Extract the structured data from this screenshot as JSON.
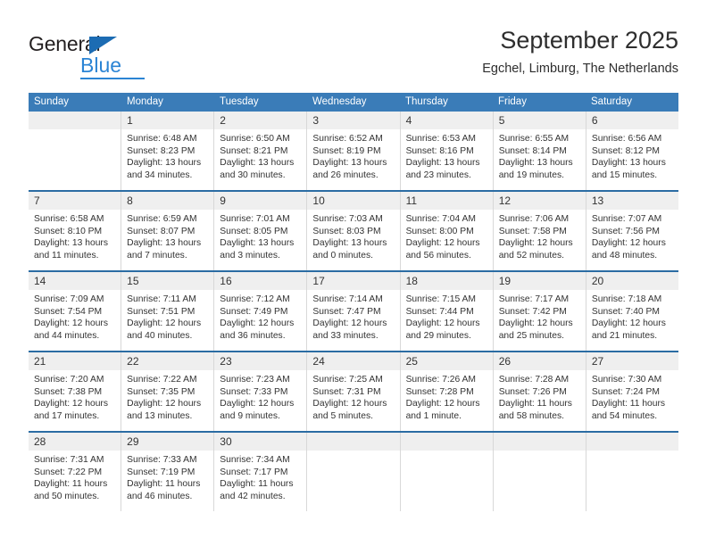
{
  "brand": {
    "name_dark": "General",
    "name_blue": "Blue",
    "triangle_color": "#1c6cb3",
    "blue_color": "#2b84d4"
  },
  "header": {
    "title": "September 2025",
    "subtitle": "Egchel, Limburg, The Netherlands"
  },
  "theme": {
    "header_row_bg": "#3a7cb8",
    "week_separator": "#2b6ca3",
    "daynum_bg": "#efefef",
    "cell_border": "#d8d8d8",
    "text": "#333333"
  },
  "calendar": {
    "weekdays": [
      "Sunday",
      "Monday",
      "Tuesday",
      "Wednesday",
      "Thursday",
      "Friday",
      "Saturday"
    ],
    "weeks": [
      [
        {
          "day": "",
          "empty": true,
          "sunrise": "",
          "sunset": "",
          "daylight1": "",
          "daylight2": ""
        },
        {
          "day": "1",
          "sunrise": "Sunrise: 6:48 AM",
          "sunset": "Sunset: 8:23 PM",
          "daylight1": "Daylight: 13 hours",
          "daylight2": "and 34 minutes."
        },
        {
          "day": "2",
          "sunrise": "Sunrise: 6:50 AM",
          "sunset": "Sunset: 8:21 PM",
          "daylight1": "Daylight: 13 hours",
          "daylight2": "and 30 minutes."
        },
        {
          "day": "3",
          "sunrise": "Sunrise: 6:52 AM",
          "sunset": "Sunset: 8:19 PM",
          "daylight1": "Daylight: 13 hours",
          "daylight2": "and 26 minutes."
        },
        {
          "day": "4",
          "sunrise": "Sunrise: 6:53 AM",
          "sunset": "Sunset: 8:16 PM",
          "daylight1": "Daylight: 13 hours",
          "daylight2": "and 23 minutes."
        },
        {
          "day": "5",
          "sunrise": "Sunrise: 6:55 AM",
          "sunset": "Sunset: 8:14 PM",
          "daylight1": "Daylight: 13 hours",
          "daylight2": "and 19 minutes."
        },
        {
          "day": "6",
          "sunrise": "Sunrise: 6:56 AM",
          "sunset": "Sunset: 8:12 PM",
          "daylight1": "Daylight: 13 hours",
          "daylight2": "and 15 minutes."
        }
      ],
      [
        {
          "day": "7",
          "sunrise": "Sunrise: 6:58 AM",
          "sunset": "Sunset: 8:10 PM",
          "daylight1": "Daylight: 13 hours",
          "daylight2": "and 11 minutes."
        },
        {
          "day": "8",
          "sunrise": "Sunrise: 6:59 AM",
          "sunset": "Sunset: 8:07 PM",
          "daylight1": "Daylight: 13 hours",
          "daylight2": "and 7 minutes."
        },
        {
          "day": "9",
          "sunrise": "Sunrise: 7:01 AM",
          "sunset": "Sunset: 8:05 PM",
          "daylight1": "Daylight: 13 hours",
          "daylight2": "and 3 minutes."
        },
        {
          "day": "10",
          "sunrise": "Sunrise: 7:03 AM",
          "sunset": "Sunset: 8:03 PM",
          "daylight1": "Daylight: 13 hours",
          "daylight2": "and 0 minutes."
        },
        {
          "day": "11",
          "sunrise": "Sunrise: 7:04 AM",
          "sunset": "Sunset: 8:00 PM",
          "daylight1": "Daylight: 12 hours",
          "daylight2": "and 56 minutes."
        },
        {
          "day": "12",
          "sunrise": "Sunrise: 7:06 AM",
          "sunset": "Sunset: 7:58 PM",
          "daylight1": "Daylight: 12 hours",
          "daylight2": "and 52 minutes."
        },
        {
          "day": "13",
          "sunrise": "Sunrise: 7:07 AM",
          "sunset": "Sunset: 7:56 PM",
          "daylight1": "Daylight: 12 hours",
          "daylight2": "and 48 minutes."
        }
      ],
      [
        {
          "day": "14",
          "sunrise": "Sunrise: 7:09 AM",
          "sunset": "Sunset: 7:54 PM",
          "daylight1": "Daylight: 12 hours",
          "daylight2": "and 44 minutes."
        },
        {
          "day": "15",
          "sunrise": "Sunrise: 7:11 AM",
          "sunset": "Sunset: 7:51 PM",
          "daylight1": "Daylight: 12 hours",
          "daylight2": "and 40 minutes."
        },
        {
          "day": "16",
          "sunrise": "Sunrise: 7:12 AM",
          "sunset": "Sunset: 7:49 PM",
          "daylight1": "Daylight: 12 hours",
          "daylight2": "and 36 minutes."
        },
        {
          "day": "17",
          "sunrise": "Sunrise: 7:14 AM",
          "sunset": "Sunset: 7:47 PM",
          "daylight1": "Daylight: 12 hours",
          "daylight2": "and 33 minutes."
        },
        {
          "day": "18",
          "sunrise": "Sunrise: 7:15 AM",
          "sunset": "Sunset: 7:44 PM",
          "daylight1": "Daylight: 12 hours",
          "daylight2": "and 29 minutes."
        },
        {
          "day": "19",
          "sunrise": "Sunrise: 7:17 AM",
          "sunset": "Sunset: 7:42 PM",
          "daylight1": "Daylight: 12 hours",
          "daylight2": "and 25 minutes."
        },
        {
          "day": "20",
          "sunrise": "Sunrise: 7:18 AM",
          "sunset": "Sunset: 7:40 PM",
          "daylight1": "Daylight: 12 hours",
          "daylight2": "and 21 minutes."
        }
      ],
      [
        {
          "day": "21",
          "sunrise": "Sunrise: 7:20 AM",
          "sunset": "Sunset: 7:38 PM",
          "daylight1": "Daylight: 12 hours",
          "daylight2": "and 17 minutes."
        },
        {
          "day": "22",
          "sunrise": "Sunrise: 7:22 AM",
          "sunset": "Sunset: 7:35 PM",
          "daylight1": "Daylight: 12 hours",
          "daylight2": "and 13 minutes."
        },
        {
          "day": "23",
          "sunrise": "Sunrise: 7:23 AM",
          "sunset": "Sunset: 7:33 PM",
          "daylight1": "Daylight: 12 hours",
          "daylight2": "and 9 minutes."
        },
        {
          "day": "24",
          "sunrise": "Sunrise: 7:25 AM",
          "sunset": "Sunset: 7:31 PM",
          "daylight1": "Daylight: 12 hours",
          "daylight2": "and 5 minutes."
        },
        {
          "day": "25",
          "sunrise": "Sunrise: 7:26 AM",
          "sunset": "Sunset: 7:28 PM",
          "daylight1": "Daylight: 12 hours",
          "daylight2": "and 1 minute."
        },
        {
          "day": "26",
          "sunrise": "Sunrise: 7:28 AM",
          "sunset": "Sunset: 7:26 PM",
          "daylight1": "Daylight: 11 hours",
          "daylight2": "and 58 minutes."
        },
        {
          "day": "27",
          "sunrise": "Sunrise: 7:30 AM",
          "sunset": "Sunset: 7:24 PM",
          "daylight1": "Daylight: 11 hours",
          "daylight2": "and 54 minutes."
        }
      ],
      [
        {
          "day": "28",
          "sunrise": "Sunrise: 7:31 AM",
          "sunset": "Sunset: 7:22 PM",
          "daylight1": "Daylight: 11 hours",
          "daylight2": "and 50 minutes."
        },
        {
          "day": "29",
          "sunrise": "Sunrise: 7:33 AM",
          "sunset": "Sunset: 7:19 PM",
          "daylight1": "Daylight: 11 hours",
          "daylight2": "and 46 minutes."
        },
        {
          "day": "30",
          "sunrise": "Sunrise: 7:34 AM",
          "sunset": "Sunset: 7:17 PM",
          "daylight1": "Daylight: 11 hours",
          "daylight2": "and 42 minutes."
        },
        {
          "day": "",
          "empty": true,
          "sunrise": "",
          "sunset": "",
          "daylight1": "",
          "daylight2": ""
        },
        {
          "day": "",
          "empty": true,
          "sunrise": "",
          "sunset": "",
          "daylight1": "",
          "daylight2": ""
        },
        {
          "day": "",
          "empty": true,
          "sunrise": "",
          "sunset": "",
          "daylight1": "",
          "daylight2": ""
        },
        {
          "day": "",
          "empty": true,
          "sunrise": "",
          "sunset": "",
          "daylight1": "",
          "daylight2": ""
        }
      ]
    ]
  }
}
